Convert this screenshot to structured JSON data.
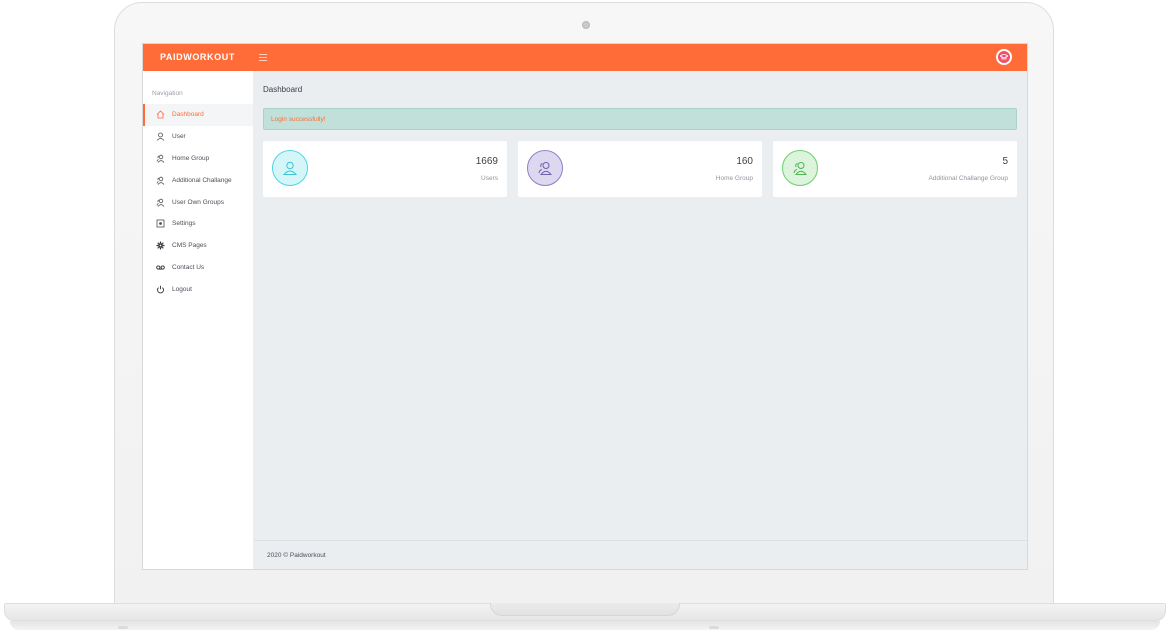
{
  "app": {
    "brand": "PAIDWORKOUT",
    "accent_color": "#ff6c37"
  },
  "header": {
    "menu_icon": "hamburger-icon",
    "avatar_icon": "user-avatar-icon"
  },
  "sidebar": {
    "heading": "Navigation",
    "items": [
      {
        "label": "Dashboard",
        "icon": "home-icon",
        "active": true
      },
      {
        "label": "User",
        "icon": "user-icon"
      },
      {
        "label": "Home Group",
        "icon": "users-icon"
      },
      {
        "label": "Additional Challange",
        "icon": "users-icon"
      },
      {
        "label": "User Own Groups",
        "icon": "users-icon"
      },
      {
        "label": "Settings",
        "icon": "settings-icon"
      },
      {
        "label": "CMS Pages",
        "icon": "gear-icon"
      },
      {
        "label": "Contact Us",
        "icon": "voicemail-icon"
      },
      {
        "label": "Logout",
        "icon": "power-icon"
      }
    ]
  },
  "main": {
    "page_title": "Dashboard",
    "alert": "Login successfully!",
    "cards": [
      {
        "value": "1669",
        "label": "Users",
        "icon": "user-icon",
        "color": "#4fd6e6"
      },
      {
        "value": "160",
        "label": "Home Group",
        "icon": "users-icon",
        "color": "#8e7fc4"
      },
      {
        "value": "5",
        "label": "Additional Challange Group",
        "icon": "users-icon",
        "color": "#6ccf6f"
      }
    ]
  },
  "footer": {
    "text": "2020 © Paidworkout"
  }
}
